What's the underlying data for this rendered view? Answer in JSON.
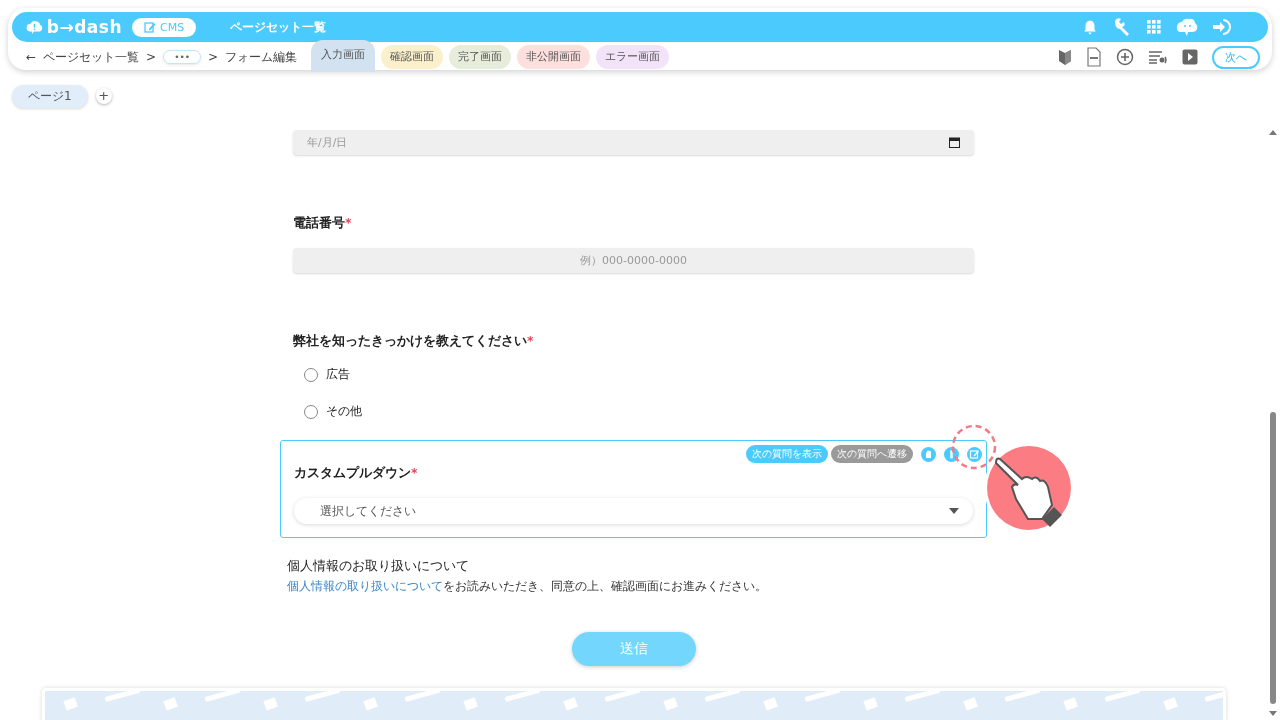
{
  "header": {
    "logo": "b→dash",
    "app_badge": "CMS",
    "title": "ページセット一覧"
  },
  "subbar": {
    "back": "←",
    "breadcrumbs": [
      {
        "kind": "link",
        "label": "ページセット一覧"
      },
      {
        "kind": "sep",
        "label": ">"
      },
      {
        "kind": "more",
        "label": "•••"
      },
      {
        "kind": "sep",
        "label": ">"
      },
      {
        "kind": "text",
        "label": "フォーム編集"
      }
    ],
    "screen_tabs": [
      {
        "label": "入力画面",
        "selected": true,
        "color": "#d3e2f1"
      },
      {
        "label": "確認画面",
        "selected": false,
        "color": "#fbf0cc"
      },
      {
        "label": "完了画面",
        "selected": false,
        "color": "#e6edda"
      },
      {
        "label": "非公開画面",
        "selected": false,
        "color": "#fde0de"
      },
      {
        "label": "エラー画面",
        "selected": false,
        "color": "#f3e3f9"
      }
    ],
    "next_button": "次へ"
  },
  "pages": [
    {
      "label": "ページ1",
      "selected": true
    }
  ],
  "add_page": "+",
  "form": {
    "fields": [
      {
        "kind": "date",
        "placeholder": "年/月/日"
      },
      {
        "kind": "text",
        "label": "電話番号",
        "required_mark": "*",
        "placeholder": "例）000-0000-0000"
      },
      {
        "kind": "radio",
        "label": "弊社を知ったきっかけを教えてください",
        "required_mark": "*",
        "options": [
          {
            "label": "広告",
            "selected": false
          },
          {
            "label": "その他",
            "selected": false
          }
        ]
      },
      {
        "kind": "select",
        "label": "カスタムプルダウン",
        "required_mark": "*",
        "focused": true,
        "placeholder": "選択してください",
        "chips": [
          {
            "label": "次の質問を表示",
            "active": true
          },
          {
            "label": "次の質問へ遷移",
            "active": false
          }
        ]
      }
    ],
    "privacy": {
      "heading": "個人情報のお取り扱いについて",
      "link": "個人情報の取り扱いについて",
      "text": "をお読みいただき、同意の上、確認画面にお進みください。"
    },
    "submit": "送信"
  }
}
